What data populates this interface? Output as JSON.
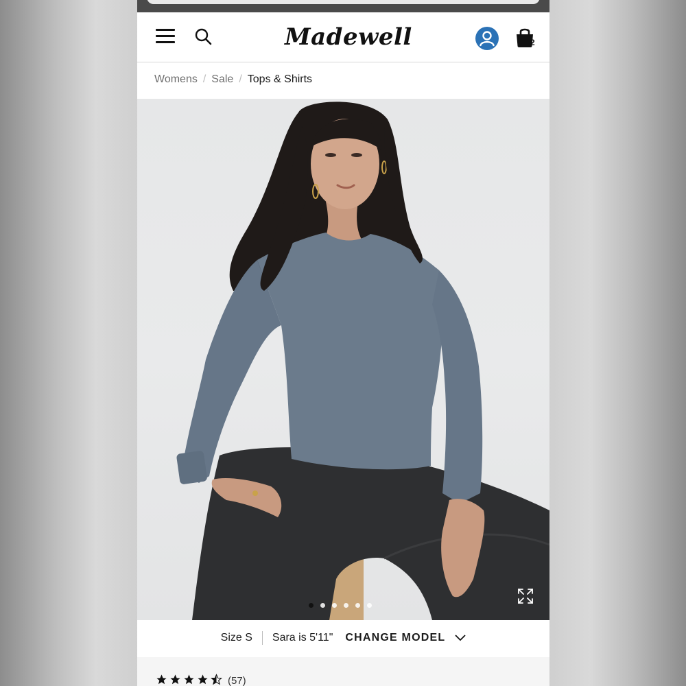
{
  "header": {
    "brand": "Madewell",
    "bag_count": "2"
  },
  "breadcrumb": {
    "items": [
      "Womens",
      "Sale",
      "Tops & Shirts"
    ]
  },
  "product_image": {
    "description_icon": "model-wearing-blue-grey-long-sleeve-top",
    "slides_total": 6,
    "slide_active": 1
  },
  "model_info": {
    "size": "Size S",
    "model": "Sara is 5'11\"",
    "change_label": "CHANGE MODEL"
  },
  "reviews": {
    "rating": 4.5,
    "count": "(57)"
  },
  "colors": {
    "accent_account": "#2b72b6",
    "shirt": "#6b7b8c"
  }
}
